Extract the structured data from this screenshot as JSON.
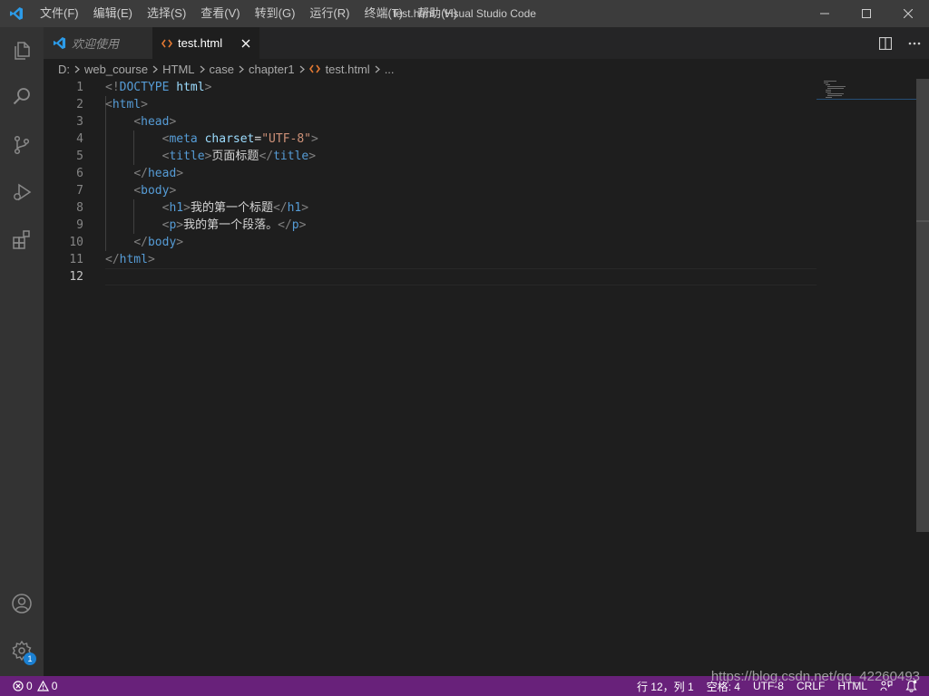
{
  "window": {
    "title": "test.html - Visual Studio Code",
    "menu": [
      "文件(F)",
      "编辑(E)",
      "选择(S)",
      "查看(V)",
      "转到(G)",
      "运行(R)",
      "终端(T)",
      "帮助(H)"
    ]
  },
  "activitybar": {
    "icons": [
      "explorer-icon",
      "search-icon",
      "source-control-icon",
      "run-debug-icon",
      "extensions-icon"
    ],
    "bottom_icons": [
      "account-icon",
      "settings-gear-icon"
    ],
    "settings_badge": "1"
  },
  "tabs": [
    {
      "label": "欢迎使用",
      "icon": "vscode-logo-icon",
      "active": false
    },
    {
      "label": "test.html",
      "icon": "html-file-icon",
      "active": true
    }
  ],
  "breadcrumb": [
    "D:",
    "web_course",
    "HTML",
    "case",
    "chapter1",
    "test.html",
    "..."
  ],
  "editor": {
    "line_numbers": [
      "1",
      "2",
      "3",
      "4",
      "5",
      "6",
      "7",
      "8",
      "9",
      "10",
      "11",
      "12"
    ],
    "lines": {
      "l1": {
        "open": "<!",
        "kw": "DOCTYPE",
        "attr": "html",
        "close": ">"
      },
      "l2": {
        "tag": "html"
      },
      "l3": {
        "tag": "head"
      },
      "l4": {
        "tag": "meta",
        "attr": "charset",
        "eq": "=",
        "value": "\"UTF-8\""
      },
      "l5": {
        "tag": "title",
        "text": "页面标题"
      },
      "l6": {
        "tag": "head"
      },
      "l7": {
        "tag": "body"
      },
      "l8": {
        "tag": "h1",
        "text": "我的第一个标题"
      },
      "l9": {
        "tag": "p",
        "text": "我的第一个段落。"
      },
      "l10": {
        "tag": "body"
      },
      "l11": {
        "tag": "html"
      }
    }
  },
  "statusbar": {
    "errors": "0",
    "warnings": "0",
    "position": "行 12，列 1",
    "indent": "空格: 4",
    "encoding": "UTF-8",
    "eol": "CRLF",
    "language": "HTML"
  },
  "watermark": "https://blog.csdn.net/qq_42260493",
  "colors": {
    "statusbar": "#68217a",
    "titlebar": "#3c3c3c",
    "activitybar": "#333333",
    "editor": "#1e1e1e",
    "tag": "#569cd6",
    "attr": "#9cdcfe",
    "string": "#ce9178"
  }
}
